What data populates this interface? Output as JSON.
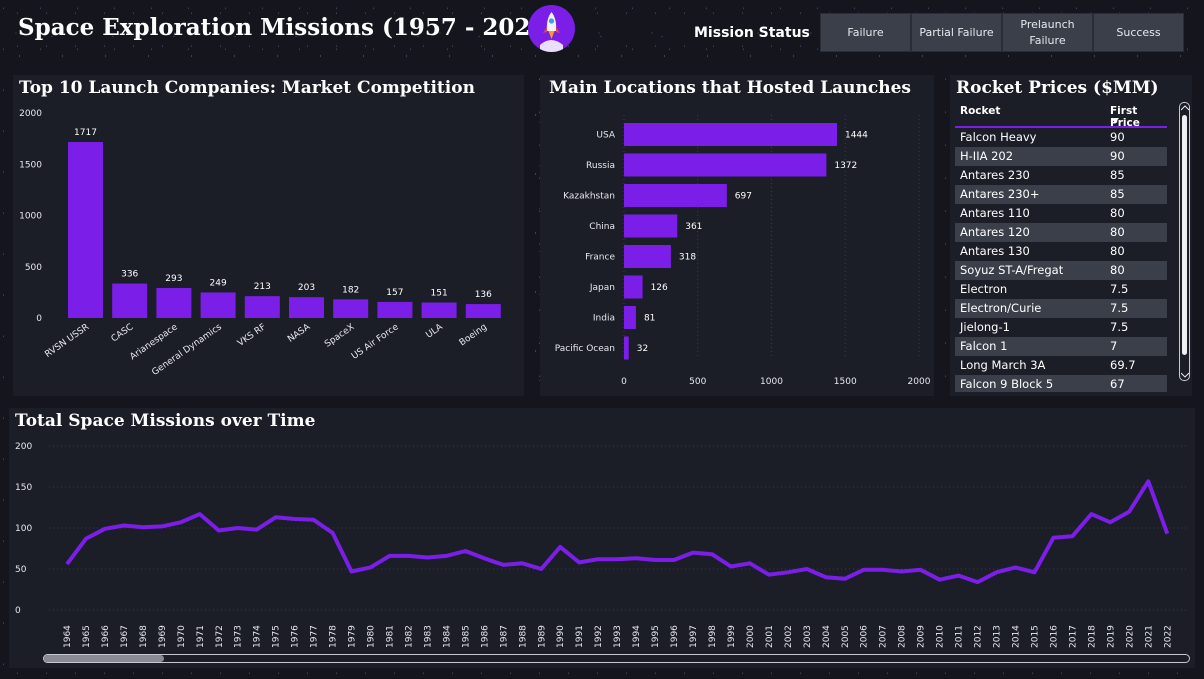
{
  "header": {
    "title": "Space Exploration Missions (1957 - 2022)",
    "status_label": "Mission Status",
    "status_buttons": [
      "Failure",
      "Partial Failure",
      "Prelaunch Failure",
      "Success"
    ]
  },
  "colors": {
    "accent": "#7b1fe8",
    "panel": "#1b1d27",
    "row_alt": "#3b3f4a"
  },
  "companies_panel": {
    "title": "Top 10 Launch Companies: Market Competition"
  },
  "locations_panel": {
    "title": "Main Locations that Hosted Launches"
  },
  "prices_panel": {
    "title": "Rocket Prices ($MM)",
    "columns": [
      "Rocket",
      "First Price"
    ],
    "rows": [
      [
        "Falcon Heavy",
        "90"
      ],
      [
        "H-IIA 202",
        "90"
      ],
      [
        "Antares 230",
        "85"
      ],
      [
        "Antares 230+",
        "85"
      ],
      [
        "Antares 110",
        "80"
      ],
      [
        "Antares 120",
        "80"
      ],
      [
        "Antares 130",
        "80"
      ],
      [
        "Soyuz ST-A/Fregat",
        "80"
      ],
      [
        "Electron",
        "7.5"
      ],
      [
        "Electron/Curie",
        "7.5"
      ],
      [
        "Jielong-1",
        "7.5"
      ],
      [
        "Falcon 1",
        "7"
      ],
      [
        "Long March 3A",
        "69.7"
      ],
      [
        "Falcon 9 Block 5",
        "67"
      ]
    ]
  },
  "timeline_panel": {
    "title": "Total Space Missions over Time"
  },
  "chart_data": [
    {
      "type": "bar",
      "title": "Top 10 Launch Companies: Market Competition",
      "categories": [
        "RVSN USSR",
        "CASC",
        "Arianespace",
        "General Dynamics",
        "VKS RF",
        "NASA",
        "SpaceX",
        "US Air Force",
        "ULA",
        "Boeing"
      ],
      "values": [
        1717,
        336,
        293,
        249,
        213,
        203,
        182,
        157,
        151,
        136
      ],
      "ylim": [
        0,
        2000
      ],
      "yticks": [
        0,
        500,
        1000,
        1500,
        2000
      ]
    },
    {
      "type": "bar",
      "orientation": "horizontal",
      "title": "Main Locations that Hosted Launches",
      "categories": [
        "USA",
        "Russia",
        "Kazakhstan",
        "China",
        "France",
        "Japan",
        "India",
        "Pacific Ocean"
      ],
      "values": [
        1444,
        1372,
        697,
        361,
        318,
        126,
        81,
        32
      ],
      "xlim": [
        0,
        2000
      ],
      "xticks": [
        0,
        500,
        1000,
        1500,
        2000
      ]
    },
    {
      "type": "line",
      "title": "Total Space Missions over Time",
      "x": [
        1964,
        1965,
        1966,
        1967,
        1968,
        1969,
        1970,
        1971,
        1972,
        1973,
        1974,
        1975,
        1976,
        1977,
        1978,
        1979,
        1980,
        1981,
        1982,
        1983,
        1984,
        1985,
        1986,
        1987,
        1988,
        1989,
        1990,
        1991,
        1992,
        1993,
        1994,
        1995,
        1996,
        1997,
        1998,
        1999,
        2000,
        2001,
        2002,
        2003,
        2004,
        2005,
        2006,
        2007,
        2008,
        2009,
        2010,
        2011,
        2012,
        2013,
        2014,
        2015,
        2016,
        2017,
        2018,
        2019,
        2020,
        2021,
        2022
      ],
      "y": [
        56,
        87,
        99,
        103,
        101,
        102,
        107,
        117,
        97,
        100,
        98,
        113,
        111,
        110,
        94,
        47,
        52,
        66,
        66,
        64,
        66,
        72,
        63,
        55,
        57,
        50,
        77,
        58,
        62,
        62,
        63,
        61,
        61,
        70,
        68,
        53,
        57,
        43,
        46,
        50,
        40,
        38,
        49,
        49,
        47,
        49,
        37,
        42,
        34,
        46,
        52,
        46,
        88,
        90,
        117,
        107,
        120,
        157,
        93
      ],
      "ylim": [
        0,
        200
      ],
      "yticks": [
        0,
        50,
        100,
        150,
        200
      ]
    }
  ]
}
